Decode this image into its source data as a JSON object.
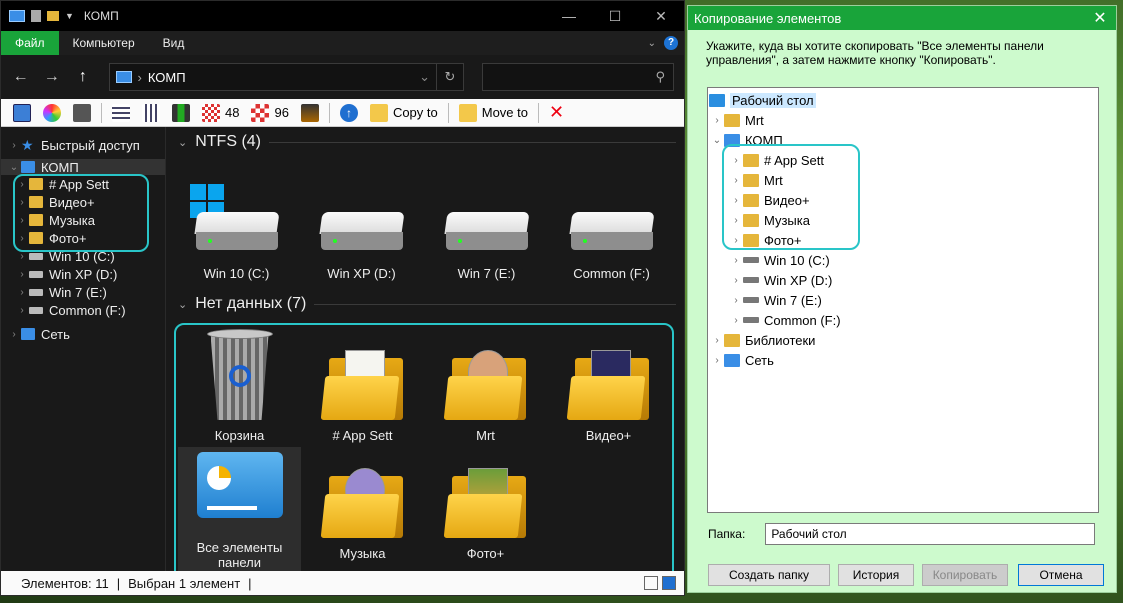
{
  "explorer": {
    "title": "КОМП",
    "ribbon_tabs": [
      "Файл",
      "Компьютер",
      "Вид"
    ],
    "address": "КОМП",
    "toolbar": {
      "num1": "48",
      "num2": "96",
      "copy_to": "Copy to",
      "move_to": "Move to"
    },
    "nav": {
      "quick_access": "Быстрый доступ",
      "this_pc": "КОМП",
      "folders": [
        "# App Sett",
        "Видео+",
        "Музыка",
        "Фото+"
      ],
      "drives": [
        "Win 10 (C:)",
        "Win XP (D:)",
        "Win 7 (E:)",
        "Common (F:)"
      ],
      "network": "Сеть"
    },
    "groups": {
      "ntfs": "NTFS (4)",
      "nodata": "Нет данных (7)"
    },
    "drives": [
      "Win 10 (C:)",
      "Win XP (D:)",
      "Win 7 (E:)",
      "Common (F:)"
    ],
    "items": [
      "Корзина",
      "# App Sett",
      "Mrt",
      "Видео+",
      "Все элементы панели управления",
      "Музыка",
      "Фото+"
    ],
    "status": {
      "count": "Элементов: 11",
      "selected": "Выбран 1 элемент"
    }
  },
  "dialog": {
    "title": "Копирование элементов",
    "instruction": "Укажите, куда вы хотите скопировать \"Все элементы панели управления\", а затем нажмите кнопку \"Копировать\".",
    "tree": {
      "desktop": "Рабочий стол",
      "mrt": "Mrt",
      "pc": "КОМП",
      "folders": [
        "# App Sett",
        "Mrt",
        "Видео+",
        "Музыка",
        "Фото+"
      ],
      "drives": [
        "Win 10 (C:)",
        "Win XP (D:)",
        "Win 7 (E:)",
        "Common (F:)"
      ],
      "libraries": "Библиотеки",
      "network": "Сеть"
    },
    "folder_label": "Папка:",
    "folder_value": "Рабочий стол",
    "buttons": {
      "new_folder": "Создать папку",
      "history": "История",
      "copy": "Копировать",
      "cancel": "Отмена"
    }
  },
  "colors": {
    "accent": "#19a43a",
    "highlight": "#29c5c8",
    "dialog_bg": "#cdfacd"
  }
}
